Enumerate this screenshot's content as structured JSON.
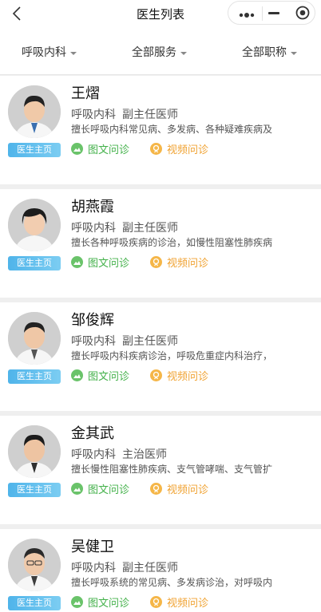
{
  "header": {
    "title": "医生列表"
  },
  "filters": {
    "department": "呼吸内科",
    "service": "全部服务",
    "rank": "全部职称"
  },
  "labels": {
    "home_button": "医生主页",
    "text_consult": "图文问诊",
    "video_consult": "视频问诊"
  },
  "doctors": [
    {
      "name": "王熠",
      "department": "呼吸内科",
      "title": "副主任医师",
      "desc": "擅长呼吸内科常见病、多发病、各种疑难疾病及"
    },
    {
      "name": "胡燕霞",
      "department": "呼吸内科",
      "title": "副主任医师",
      "desc": "擅长各种呼吸疾病的诊治，如慢性阻塞性肺疾病"
    },
    {
      "name": "邹俊辉",
      "department": "呼吸内科",
      "title": "副主任医师",
      "desc": "擅长呼吸内科疾病诊治，呼吸危重症内科治疗，"
    },
    {
      "name": "金其武",
      "department": "呼吸内科",
      "title": "主治医师",
      "desc": "擅长慢性阻塞性肺疾病、支气管哮喘、支气管扩"
    },
    {
      "name": "吴健卫",
      "department": "呼吸内科",
      "title": "副主任医师",
      "desc": "擅长呼吸系统的常见病、多发病诊治，对呼吸内"
    }
  ],
  "icons": {
    "back": "chevron-left-icon",
    "more": "more-dots-icon",
    "minimize": "minus-icon",
    "close": "target-circle-icon",
    "text_consult": "image-icon",
    "video_consult": "video-icon"
  },
  "colors": {
    "home_button": "#5fbdee",
    "text_consult": "#43b14a",
    "video_consult": "#f0a231"
  }
}
